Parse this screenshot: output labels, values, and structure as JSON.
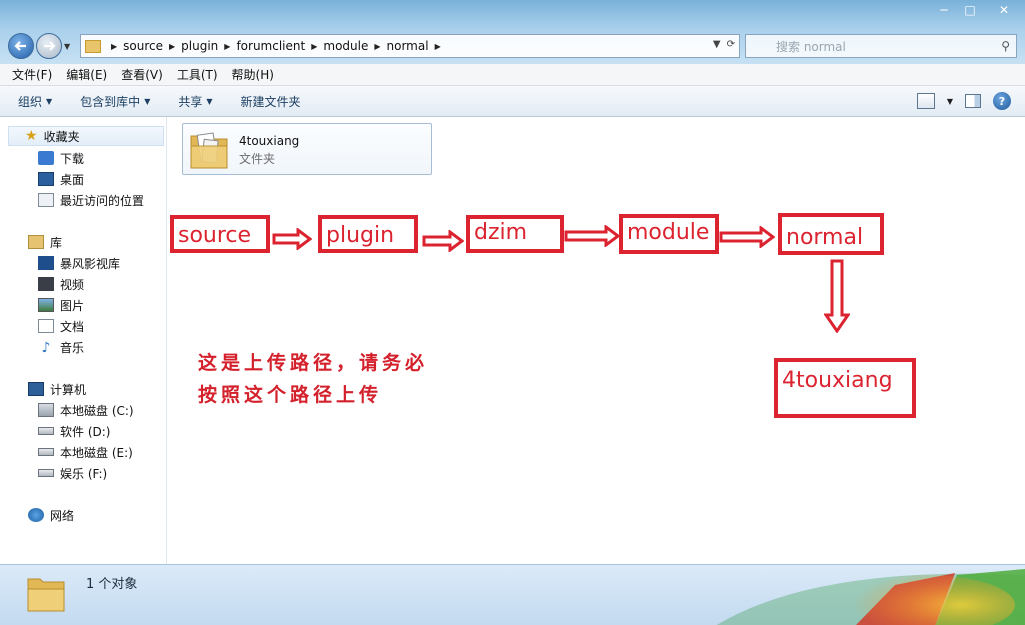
{
  "window": {
    "controls": {
      "minimize": "─",
      "maximize": "□",
      "close": "✕"
    }
  },
  "address": {
    "crumbs": [
      "source",
      "plugin",
      "forumclient",
      "module",
      "normal"
    ]
  },
  "search": {
    "placeholder": "搜索 normal"
  },
  "menubar": [
    "文件(F)",
    "编辑(E)",
    "查看(V)",
    "工具(T)",
    "帮助(H)"
  ],
  "toolbar": {
    "organize": "组织",
    "include_library": "包含到库中",
    "share": "共享",
    "new_folder": "新建文件夹"
  },
  "sidebar": {
    "favorites": {
      "label": "收藏夹",
      "items": [
        "下载",
        "桌面",
        "最近访问的位置"
      ]
    },
    "libraries": {
      "label": "库",
      "items": [
        "暴风影视库",
        "视频",
        "图片",
        "文档",
        "音乐"
      ]
    },
    "computer": {
      "label": "计算机",
      "items": [
        "本地磁盘 (C:)",
        "软件 (D:)",
        "本地磁盘 (E:)",
        "娱乐 (F:)"
      ]
    },
    "network": {
      "label": "网络"
    }
  },
  "content": {
    "folder": {
      "name": "4touxiang",
      "type": "文件夹"
    },
    "path_boxes": [
      "source",
      "plugin",
      "dzim",
      "module",
      "normal"
    ],
    "target_box": "4touxiang",
    "note": "这是上传路径，请务必按照这个路径上传"
  },
  "status": {
    "count": "1 个对象"
  },
  "colors": {
    "annotation_red": "#dc2330",
    "accent_blue": "#c3daf0"
  }
}
